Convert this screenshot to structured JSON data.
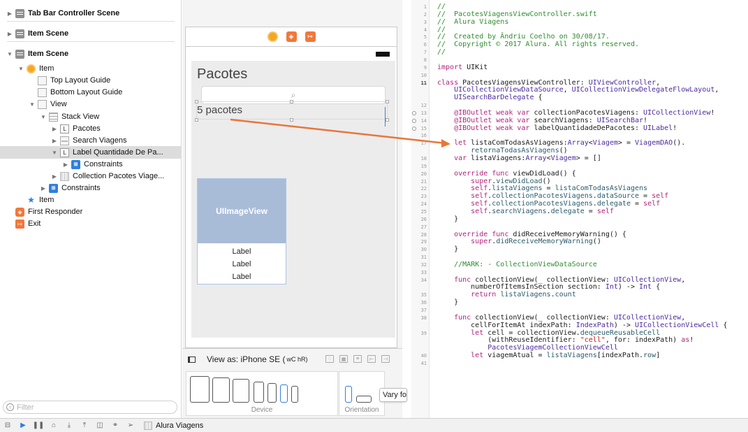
{
  "outline": {
    "rows": [
      {
        "label": "Tab Bar Controller Scene",
        "bold": true,
        "disclosure": "right",
        "icon": "scene-icon",
        "indent": 0
      },
      {
        "label": "Item Scene",
        "bold": true,
        "disclosure": "right",
        "icon": "scene-icon",
        "indent": 0
      },
      {
        "label": "Item Scene",
        "bold": true,
        "disclosure": "down",
        "icon": "scene-icon",
        "indent": 0
      },
      {
        "label": "Item",
        "bold": false,
        "disclosure": "down",
        "icon": "view-controller-icon",
        "indent": 1
      },
      {
        "label": "Top Layout Guide",
        "bold": false,
        "disclosure": "none",
        "icon": "layout-guide-icon",
        "indent": 2
      },
      {
        "label": "Bottom Layout Guide",
        "bold": false,
        "disclosure": "none",
        "icon": "layout-guide-icon",
        "indent": 2
      },
      {
        "label": "View",
        "bold": false,
        "disclosure": "down",
        "icon": "view-icon",
        "indent": 2
      },
      {
        "label": "Stack View",
        "bold": false,
        "disclosure": "down",
        "icon": "stack-view-icon",
        "indent": 3
      },
      {
        "label": "Pacotes",
        "bold": false,
        "disclosure": "right",
        "icon": "label-icon",
        "indent": 4
      },
      {
        "label": "Search Viagens",
        "bold": false,
        "disclosure": "right",
        "icon": "search-bar-icon",
        "indent": 4
      },
      {
        "label": "Label Quantidade De Pa...",
        "bold": false,
        "disclosure": "down",
        "icon": "label-icon",
        "indent": 4,
        "selected": true
      },
      {
        "label": "Constraints",
        "bold": false,
        "disclosure": "right",
        "icon": "constraints-icon",
        "indent": 5
      },
      {
        "label": "Collection Pacotes Viage...",
        "bold": false,
        "disclosure": "right",
        "icon": "collection-view-icon",
        "indent": 4
      },
      {
        "label": "Constraints",
        "bold": false,
        "disclosure": "right",
        "icon": "constraints-icon",
        "indent": 3
      },
      {
        "label": "Item",
        "bold": false,
        "disclosure": "none",
        "icon": "tab-bar-item-icon",
        "indent": 1
      },
      {
        "label": "First Responder",
        "bold": false,
        "disclosure": "none",
        "icon": "first-responder-icon",
        "indent": 0
      },
      {
        "label": "Exit",
        "bold": false,
        "disclosure": "none",
        "icon": "exit-icon",
        "indent": 0
      }
    ],
    "filter_placeholder": "Filter"
  },
  "canvas": {
    "nav_title": "Pacotes",
    "count_label": "5 pacotes",
    "image_view_label": "UIImageView",
    "cell_labels": [
      "Label",
      "Label",
      "Label"
    ],
    "view_as": "View as: iPhone SE (",
    "view_as_size": "wC hR)",
    "device_caption": "Device",
    "orientation_caption": "Orientation",
    "vary_button": "Vary fo"
  },
  "editor": {
    "lines": [
      {
        "n": "1",
        "segs": [
          [
            "cm",
            "//"
          ]
        ]
      },
      {
        "n": "2",
        "segs": [
          [
            "cm",
            "//  PacotesViagensViewController.swift"
          ]
        ]
      },
      {
        "n": "3",
        "segs": [
          [
            "cm",
            "//  Alura Viagens"
          ]
        ]
      },
      {
        "n": "4",
        "segs": [
          [
            "cm",
            "//"
          ]
        ]
      },
      {
        "n": "5",
        "segs": [
          [
            "cm",
            "//  Created by Ândriu Coelho on 30/08/17."
          ]
        ]
      },
      {
        "n": "6",
        "segs": [
          [
            "cm",
            "//  Copyright © 2017 Alura. All rights reserved."
          ]
        ]
      },
      {
        "n": "7",
        "segs": [
          [
            "cm",
            "//"
          ]
        ]
      },
      {
        "n": "8",
        "segs": []
      },
      {
        "n": "9",
        "segs": [
          [
            "kw",
            "import"
          ],
          [
            "pl",
            " UIKit"
          ]
        ]
      },
      {
        "n": "10",
        "segs": []
      },
      {
        "n": "11",
        "bold": true,
        "segs": [
          [
            "kw",
            "class"
          ],
          [
            "pl",
            " PacotesViagensViewController: "
          ],
          [
            "ty",
            "UIViewController"
          ],
          [
            "pl",
            ","
          ]
        ]
      },
      {
        "n": "",
        "segs": [
          [
            "ty",
            "    UICollectionViewDataSource"
          ],
          [
            "pl",
            ", "
          ],
          [
            "ty",
            "UICollectionViewDelegateFlowLayout"
          ],
          [
            "pl",
            ","
          ]
        ]
      },
      {
        "n": "",
        "segs": [
          [
            "ty",
            "    UISearchBarDelegate"
          ],
          [
            "pl",
            " {"
          ]
        ]
      },
      {
        "n": "12",
        "segs": []
      },
      {
        "n": "13",
        "dot": true,
        "segs": [
          [
            "kw",
            "    @IBOutlet weak var"
          ],
          [
            "pl",
            " collectionPacotesViagens: "
          ],
          [
            "ty",
            "UICollectionView"
          ],
          [
            "pl",
            "!"
          ]
        ]
      },
      {
        "n": "14",
        "dot": true,
        "segs": [
          [
            "kw",
            "    @IBOutlet weak var"
          ],
          [
            "pl",
            " searchViagens: "
          ],
          [
            "ty",
            "UISearchBar"
          ],
          [
            "pl",
            "!"
          ]
        ]
      },
      {
        "n": "15",
        "dot": true,
        "segs": [
          [
            "kw",
            "    @IBOutlet weak var"
          ],
          [
            "pl",
            " labelQuantidadeDePacotes: "
          ],
          [
            "ty",
            "UILabel"
          ],
          [
            "pl",
            "!"
          ]
        ]
      },
      {
        "n": "16",
        "segs": []
      },
      {
        "n": "17",
        "segs": [
          [
            "kw",
            "    let"
          ],
          [
            "pl",
            " listaComTodasAsViagens:"
          ],
          [
            "ty",
            "Array"
          ],
          [
            "pl",
            "<"
          ],
          [
            "ty",
            "Viagem"
          ],
          [
            "pl",
            "> = "
          ],
          [
            "ty",
            "ViagemDAO"
          ],
          [
            "pl",
            "()."
          ]
        ]
      },
      {
        "n": "",
        "segs": [
          [
            "fn",
            "        retornaTodasAsViagens"
          ],
          [
            "pl",
            "()"
          ]
        ]
      },
      {
        "n": "18",
        "segs": [
          [
            "kw",
            "    var"
          ],
          [
            "pl",
            " listaViagens:"
          ],
          [
            "ty",
            "Array"
          ],
          [
            "pl",
            "<"
          ],
          [
            "ty",
            "Viagem"
          ],
          [
            "pl",
            "> = []"
          ]
        ]
      },
      {
        "n": "19",
        "segs": []
      },
      {
        "n": "20",
        "segs": [
          [
            "kw",
            "    override func"
          ],
          [
            "pl",
            " viewDidLoad() {"
          ]
        ]
      },
      {
        "n": "21",
        "segs": [
          [
            "kw",
            "        super"
          ],
          [
            "pl",
            "."
          ],
          [
            "fn",
            "viewDidLoad"
          ],
          [
            "pl",
            "()"
          ]
        ]
      },
      {
        "n": "22",
        "segs": [
          [
            "kw",
            "        self"
          ],
          [
            "pl",
            "."
          ],
          [
            "fn",
            "listaViagens"
          ],
          [
            "pl",
            " = "
          ],
          [
            "fn",
            "listaComTodasAsViagens"
          ]
        ]
      },
      {
        "n": "23",
        "segs": [
          [
            "kw",
            "        self"
          ],
          [
            "pl",
            "."
          ],
          [
            "fn",
            "collectionPacotesViagens"
          ],
          [
            "pl",
            "."
          ],
          [
            "fn",
            "dataSource"
          ],
          [
            "pl",
            " = "
          ],
          [
            "kw",
            "self"
          ]
        ]
      },
      {
        "n": "24",
        "segs": [
          [
            "kw",
            "        self"
          ],
          [
            "pl",
            "."
          ],
          [
            "fn",
            "collectionPacotesViagens"
          ],
          [
            "pl",
            "."
          ],
          [
            "fn",
            "delegate"
          ],
          [
            "pl",
            " = "
          ],
          [
            "kw",
            "self"
          ]
        ]
      },
      {
        "n": "25",
        "segs": [
          [
            "kw",
            "        self"
          ],
          [
            "pl",
            "."
          ],
          [
            "fn",
            "searchViagens"
          ],
          [
            "pl",
            "."
          ],
          [
            "fn",
            "delegate"
          ],
          [
            "pl",
            " = "
          ],
          [
            "kw",
            "self"
          ]
        ]
      },
      {
        "n": "26",
        "segs": [
          [
            "pl",
            "    }"
          ]
        ]
      },
      {
        "n": "27",
        "segs": []
      },
      {
        "n": "28",
        "segs": [
          [
            "kw",
            "    override func"
          ],
          [
            "pl",
            " didReceiveMemoryWarning() {"
          ]
        ]
      },
      {
        "n": "29",
        "segs": [
          [
            "kw",
            "        super"
          ],
          [
            "pl",
            "."
          ],
          [
            "fn",
            "didReceiveMemoryWarning"
          ],
          [
            "pl",
            "()"
          ]
        ]
      },
      {
        "n": "30",
        "segs": [
          [
            "pl",
            "    }"
          ]
        ]
      },
      {
        "n": "31",
        "segs": []
      },
      {
        "n": "32",
        "segs": [
          [
            "cm",
            "    //MARK: - CollectionViewDataSource"
          ]
        ]
      },
      {
        "n": "33",
        "segs": []
      },
      {
        "n": "34",
        "segs": [
          [
            "kw",
            "    func"
          ],
          [
            "pl",
            " collectionView(_ collectionView: "
          ],
          [
            "ty",
            "UICollectionView"
          ],
          [
            "pl",
            ","
          ]
        ]
      },
      {
        "n": "",
        "segs": [
          [
            "pl",
            "        numberOfItemsInSection section: "
          ],
          [
            "ty",
            "Int"
          ],
          [
            "pl",
            ") -> "
          ],
          [
            "ty",
            "Int"
          ],
          [
            "pl",
            " {"
          ]
        ]
      },
      {
        "n": "35",
        "segs": [
          [
            "kw",
            "        return"
          ],
          [
            "pl",
            " "
          ],
          [
            "fn",
            "listaViagens"
          ],
          [
            "pl",
            "."
          ],
          [
            "fn",
            "count"
          ]
        ]
      },
      {
        "n": "36",
        "segs": [
          [
            "pl",
            "    }"
          ]
        ]
      },
      {
        "n": "37",
        "segs": []
      },
      {
        "n": "38",
        "segs": [
          [
            "kw",
            "    func"
          ],
          [
            "pl",
            " collectionView(_ collectionView: "
          ],
          [
            "ty",
            "UICollectionView"
          ],
          [
            "pl",
            ","
          ]
        ]
      },
      {
        "n": "",
        "segs": [
          [
            "pl",
            "        cellForItemAt indexPath: "
          ],
          [
            "ty",
            "IndexPath"
          ],
          [
            "pl",
            ") -> "
          ],
          [
            "ty",
            "UICollectionViewCell"
          ],
          [
            "pl",
            " {"
          ]
        ]
      },
      {
        "n": "39",
        "segs": [
          [
            "kw",
            "        let"
          ],
          [
            "pl",
            " cell = collectionView."
          ],
          [
            "fn",
            "dequeueReusableCell"
          ]
        ]
      },
      {
        "n": "",
        "segs": [
          [
            "pl",
            "            (withReuseIdentifier: "
          ],
          [
            "st",
            "\"cell\""
          ],
          [
            "pl",
            ", for: indexPath) "
          ],
          [
            "kw",
            "as"
          ],
          [
            "pl",
            "!"
          ]
        ]
      },
      {
        "n": "",
        "segs": [
          [
            "ty",
            "            PacotesViagemCollectionViewCell"
          ]
        ]
      },
      {
        "n": "40",
        "segs": [
          [
            "kw",
            "        let"
          ],
          [
            "pl",
            " viagemAtual = "
          ],
          [
            "fn",
            "listaViagens"
          ],
          [
            "pl",
            "[indexPath."
          ],
          [
            "fn",
            "row"
          ],
          [
            "pl",
            "]"
          ]
        ]
      },
      {
        "n": "41",
        "segs": []
      }
    ]
  },
  "debugbar": {
    "scheme_label": "Alura Viagens"
  },
  "colors": {
    "selection_row": "#dcdcdc",
    "connection_arrow": "#e8763a",
    "image_view_fill": "#a8bcd8",
    "comment": "#2e8c2e",
    "keyword": "#b0247c",
    "type": "#4b2a9e"
  }
}
